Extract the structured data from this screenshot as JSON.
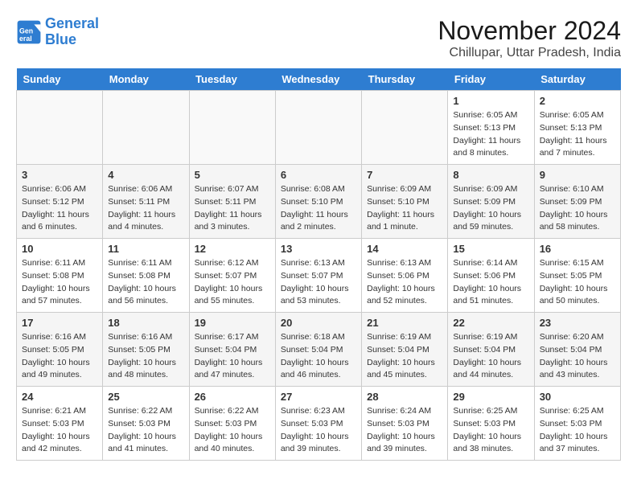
{
  "header": {
    "logo_line1": "General",
    "logo_line2": "Blue",
    "month_title": "November 2024",
    "location": "Chillupar, Uttar Pradesh, India"
  },
  "days_of_week": [
    "Sunday",
    "Monday",
    "Tuesday",
    "Wednesday",
    "Thursday",
    "Friday",
    "Saturday"
  ],
  "weeks": [
    [
      {
        "day": "",
        "sunrise": "",
        "sunset": "",
        "daylight": "",
        "empty": true
      },
      {
        "day": "",
        "sunrise": "",
        "sunset": "",
        "daylight": "",
        "empty": true
      },
      {
        "day": "",
        "sunrise": "",
        "sunset": "",
        "daylight": "",
        "empty": true
      },
      {
        "day": "",
        "sunrise": "",
        "sunset": "",
        "daylight": "",
        "empty": true
      },
      {
        "day": "",
        "sunrise": "",
        "sunset": "",
        "daylight": "",
        "empty": true
      },
      {
        "day": "1",
        "sunrise": "Sunrise: 6:05 AM",
        "sunset": "Sunset: 5:13 PM",
        "daylight": "Daylight: 11 hours and 8 minutes.",
        "empty": false
      },
      {
        "day": "2",
        "sunrise": "Sunrise: 6:05 AM",
        "sunset": "Sunset: 5:13 PM",
        "daylight": "Daylight: 11 hours and 7 minutes.",
        "empty": false
      }
    ],
    [
      {
        "day": "3",
        "sunrise": "Sunrise: 6:06 AM",
        "sunset": "Sunset: 5:12 PM",
        "daylight": "Daylight: 11 hours and 6 minutes.",
        "empty": false
      },
      {
        "day": "4",
        "sunrise": "Sunrise: 6:06 AM",
        "sunset": "Sunset: 5:11 PM",
        "daylight": "Daylight: 11 hours and 4 minutes.",
        "empty": false
      },
      {
        "day": "5",
        "sunrise": "Sunrise: 6:07 AM",
        "sunset": "Sunset: 5:11 PM",
        "daylight": "Daylight: 11 hours and 3 minutes.",
        "empty": false
      },
      {
        "day": "6",
        "sunrise": "Sunrise: 6:08 AM",
        "sunset": "Sunset: 5:10 PM",
        "daylight": "Daylight: 11 hours and 2 minutes.",
        "empty": false
      },
      {
        "day": "7",
        "sunrise": "Sunrise: 6:09 AM",
        "sunset": "Sunset: 5:10 PM",
        "daylight": "Daylight: 11 hours and 1 minute.",
        "empty": false
      },
      {
        "day": "8",
        "sunrise": "Sunrise: 6:09 AM",
        "sunset": "Sunset: 5:09 PM",
        "daylight": "Daylight: 10 hours and 59 minutes.",
        "empty": false
      },
      {
        "day": "9",
        "sunrise": "Sunrise: 6:10 AM",
        "sunset": "Sunset: 5:09 PM",
        "daylight": "Daylight: 10 hours and 58 minutes.",
        "empty": false
      }
    ],
    [
      {
        "day": "10",
        "sunrise": "Sunrise: 6:11 AM",
        "sunset": "Sunset: 5:08 PM",
        "daylight": "Daylight: 10 hours and 57 minutes.",
        "empty": false
      },
      {
        "day": "11",
        "sunrise": "Sunrise: 6:11 AM",
        "sunset": "Sunset: 5:08 PM",
        "daylight": "Daylight: 10 hours and 56 minutes.",
        "empty": false
      },
      {
        "day": "12",
        "sunrise": "Sunrise: 6:12 AM",
        "sunset": "Sunset: 5:07 PM",
        "daylight": "Daylight: 10 hours and 55 minutes.",
        "empty": false
      },
      {
        "day": "13",
        "sunrise": "Sunrise: 6:13 AM",
        "sunset": "Sunset: 5:07 PM",
        "daylight": "Daylight: 10 hours and 53 minutes.",
        "empty": false
      },
      {
        "day": "14",
        "sunrise": "Sunrise: 6:13 AM",
        "sunset": "Sunset: 5:06 PM",
        "daylight": "Daylight: 10 hours and 52 minutes.",
        "empty": false
      },
      {
        "day": "15",
        "sunrise": "Sunrise: 6:14 AM",
        "sunset": "Sunset: 5:06 PM",
        "daylight": "Daylight: 10 hours and 51 minutes.",
        "empty": false
      },
      {
        "day": "16",
        "sunrise": "Sunrise: 6:15 AM",
        "sunset": "Sunset: 5:05 PM",
        "daylight": "Daylight: 10 hours and 50 minutes.",
        "empty": false
      }
    ],
    [
      {
        "day": "17",
        "sunrise": "Sunrise: 6:16 AM",
        "sunset": "Sunset: 5:05 PM",
        "daylight": "Daylight: 10 hours and 49 minutes.",
        "empty": false
      },
      {
        "day": "18",
        "sunrise": "Sunrise: 6:16 AM",
        "sunset": "Sunset: 5:05 PM",
        "daylight": "Daylight: 10 hours and 48 minutes.",
        "empty": false
      },
      {
        "day": "19",
        "sunrise": "Sunrise: 6:17 AM",
        "sunset": "Sunset: 5:04 PM",
        "daylight": "Daylight: 10 hours and 47 minutes.",
        "empty": false
      },
      {
        "day": "20",
        "sunrise": "Sunrise: 6:18 AM",
        "sunset": "Sunset: 5:04 PM",
        "daylight": "Daylight: 10 hours and 46 minutes.",
        "empty": false
      },
      {
        "day": "21",
        "sunrise": "Sunrise: 6:19 AM",
        "sunset": "Sunset: 5:04 PM",
        "daylight": "Daylight: 10 hours and 45 minutes.",
        "empty": false
      },
      {
        "day": "22",
        "sunrise": "Sunrise: 6:19 AM",
        "sunset": "Sunset: 5:04 PM",
        "daylight": "Daylight: 10 hours and 44 minutes.",
        "empty": false
      },
      {
        "day": "23",
        "sunrise": "Sunrise: 6:20 AM",
        "sunset": "Sunset: 5:04 PM",
        "daylight": "Daylight: 10 hours and 43 minutes.",
        "empty": false
      }
    ],
    [
      {
        "day": "24",
        "sunrise": "Sunrise: 6:21 AM",
        "sunset": "Sunset: 5:03 PM",
        "daylight": "Daylight: 10 hours and 42 minutes.",
        "empty": false
      },
      {
        "day": "25",
        "sunrise": "Sunrise: 6:22 AM",
        "sunset": "Sunset: 5:03 PM",
        "daylight": "Daylight: 10 hours and 41 minutes.",
        "empty": false
      },
      {
        "day": "26",
        "sunrise": "Sunrise: 6:22 AM",
        "sunset": "Sunset: 5:03 PM",
        "daylight": "Daylight: 10 hours and 40 minutes.",
        "empty": false
      },
      {
        "day": "27",
        "sunrise": "Sunrise: 6:23 AM",
        "sunset": "Sunset: 5:03 PM",
        "daylight": "Daylight: 10 hours and 39 minutes.",
        "empty": false
      },
      {
        "day": "28",
        "sunrise": "Sunrise: 6:24 AM",
        "sunset": "Sunset: 5:03 PM",
        "daylight": "Daylight: 10 hours and 39 minutes.",
        "empty": false
      },
      {
        "day": "29",
        "sunrise": "Sunrise: 6:25 AM",
        "sunset": "Sunset: 5:03 PM",
        "daylight": "Daylight: 10 hours and 38 minutes.",
        "empty": false
      },
      {
        "day": "30",
        "sunrise": "Sunrise: 6:25 AM",
        "sunset": "Sunset: 5:03 PM",
        "daylight": "Daylight: 10 hours and 37 minutes.",
        "empty": false
      }
    ]
  ]
}
